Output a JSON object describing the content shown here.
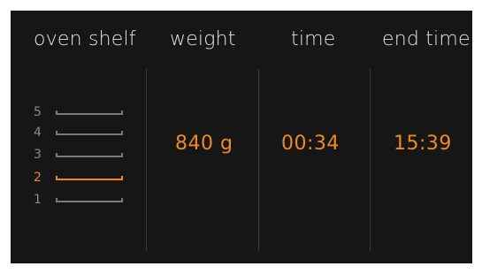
{
  "headers": {
    "oven_shelf": "oven shelf",
    "weight": "weight",
    "time": "time",
    "end_time": "end time"
  },
  "shelves": [
    {
      "number": "5",
      "selected": false
    },
    {
      "number": "4",
      "selected": false
    },
    {
      "number": "3",
      "selected": false
    },
    {
      "number": "2",
      "selected": true
    },
    {
      "number": "1",
      "selected": false
    }
  ],
  "values": {
    "weight": "840 g",
    "time": "00:34",
    "end_time": "15:39"
  },
  "colors": {
    "background": "#161616",
    "accent": "#f08a1d",
    "header_text": "#e4e4e4",
    "inactive": "#7a7a7a"
  }
}
